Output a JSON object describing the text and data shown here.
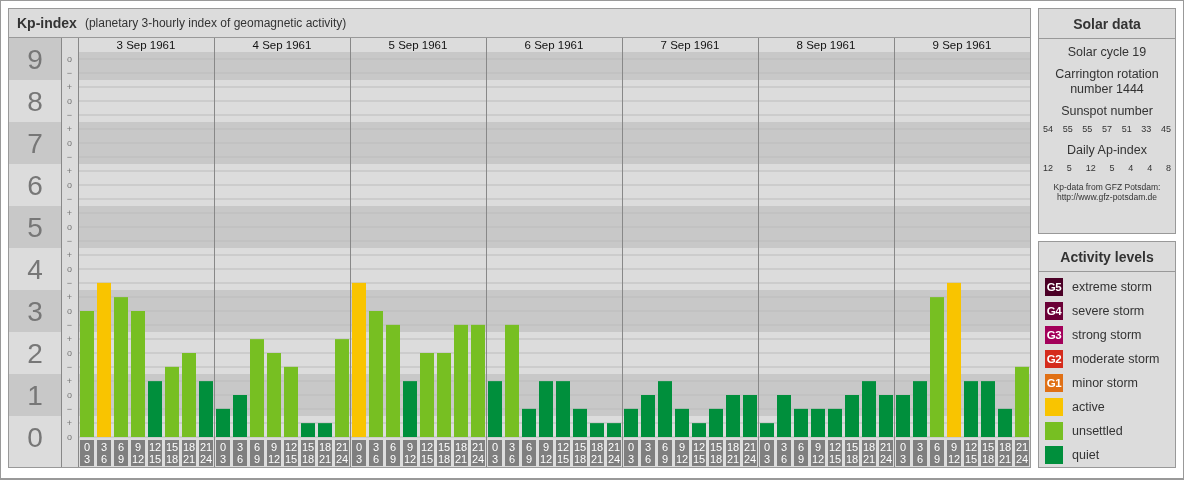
{
  "main": {
    "title": "Kp-index",
    "subtitle": "(planetary 3-hourly index of geomagnetic activity)"
  },
  "kp_chart": {
    "days": [
      {
        "date": "3 Sep 1961",
        "slots": [
          {
            "from": "0",
            "to": "3"
          },
          {
            "from": "3",
            "to": "6"
          },
          {
            "from": "6",
            "to": "9"
          },
          {
            "from": "9",
            "to": "12"
          },
          {
            "from": "12",
            "to": "15"
          },
          {
            "from": "15",
            "to": "18"
          },
          {
            "from": "18",
            "to": "21"
          },
          {
            "from": "21",
            "to": "24"
          }
        ]
      },
      {
        "date": "4 Sep 1961",
        "slots": [
          {
            "from": "0",
            "to": "3"
          },
          {
            "from": "3",
            "to": "6"
          },
          {
            "from": "6",
            "to": "9"
          },
          {
            "from": "9",
            "to": "12"
          },
          {
            "from": "12",
            "to": "15"
          },
          {
            "from": "15",
            "to": "18"
          },
          {
            "from": "18",
            "to": "21"
          },
          {
            "from": "21",
            "to": "24"
          }
        ]
      },
      {
        "date": "5 Sep 1961",
        "slots": [
          {
            "from": "0",
            "to": "3"
          },
          {
            "from": "3",
            "to": "6"
          },
          {
            "from": "6",
            "to": "9"
          },
          {
            "from": "9",
            "to": "12"
          },
          {
            "from": "12",
            "to": "15"
          },
          {
            "from": "15",
            "to": "18"
          },
          {
            "from": "18",
            "to": "21"
          },
          {
            "from": "21",
            "to": "24"
          }
        ]
      },
      {
        "date": "6 Sep 1961",
        "slots": [
          {
            "from": "0",
            "to": "3"
          },
          {
            "from": "3",
            "to": "6"
          },
          {
            "from": "6",
            "to": "9"
          },
          {
            "from": "9",
            "to": "12"
          },
          {
            "from": "12",
            "to": "15"
          },
          {
            "from": "15",
            "to": "18"
          },
          {
            "from": "18",
            "to": "21"
          },
          {
            "from": "21",
            "to": "24"
          }
        ]
      },
      {
        "date": "7 Sep 1961",
        "slots": [
          {
            "from": "0",
            "to": "3"
          },
          {
            "from": "3",
            "to": "6"
          },
          {
            "from": "6",
            "to": "9"
          },
          {
            "from": "9",
            "to": "12"
          },
          {
            "from": "12",
            "to": "15"
          },
          {
            "from": "15",
            "to": "18"
          },
          {
            "from": "18",
            "to": "21"
          },
          {
            "from": "21",
            "to": "24"
          }
        ]
      },
      {
        "date": "8 Sep 1961",
        "slots": [
          {
            "from": "0",
            "to": "3"
          },
          {
            "from": "3",
            "to": "6"
          },
          {
            "from": "6",
            "to": "9"
          },
          {
            "from": "9",
            "to": "12"
          },
          {
            "from": "12",
            "to": "15"
          },
          {
            "from": "15",
            "to": "18"
          },
          {
            "from": "18",
            "to": "21"
          },
          {
            "from": "21",
            "to": "24"
          }
        ]
      },
      {
        "date": "9 Sep 1961",
        "slots": [
          {
            "from": "0",
            "to": "3"
          },
          {
            "from": "3",
            "to": "6"
          },
          {
            "from": "6",
            "to": "9"
          },
          {
            "from": "9",
            "to": "12"
          },
          {
            "from": "12",
            "to": "15"
          },
          {
            "from": "15",
            "to": "18"
          },
          {
            "from": "18",
            "to": "21"
          },
          {
            "from": "21",
            "to": "24"
          }
        ]
      }
    ],
    "minor_ticks": [
      "o",
      "−",
      "+",
      "o",
      "−",
      "+",
      "o",
      "−",
      "+",
      "o",
      "−",
      "+",
      "o",
      "−",
      "+",
      "o",
      "−",
      "+",
      "o",
      "−",
      "+",
      "o",
      "−",
      "+",
      "o",
      "−",
      "+",
      "o"
    ],
    "chart_data": {
      "type": "bar",
      "ylim": [
        0,
        9
      ],
      "grid": true,
      "bands": [
        {
          "axis": "y",
          "from": 0.5,
          "to": 1.5
        },
        {
          "axis": "y",
          "from": 2.5,
          "to": 3.5
        },
        {
          "axis": "y",
          "from": 4.5,
          "to": 5.5
        },
        {
          "axis": "y",
          "from": 6.5,
          "to": 7.5
        },
        {
          "axis": "y",
          "from": 8.5,
          "to": 9.5
        }
      ],
      "yticks": [
        {
          "value": 0,
          "label": "0"
        },
        {
          "value": 1,
          "label": "1"
        },
        {
          "value": 2,
          "label": "2"
        },
        {
          "value": 3,
          "label": "3"
        },
        {
          "value": 4,
          "label": "4"
        },
        {
          "value": 5,
          "label": "5"
        },
        {
          "value": 6,
          "label": "6"
        },
        {
          "value": 7,
          "label": "7"
        },
        {
          "value": 8,
          "label": "8"
        },
        {
          "value": 9,
          "label": "9"
        }
      ],
      "values": [
        3,
        3.67,
        3.33,
        3,
        1.33,
        1.67,
        2,
        1.33,
        0.67,
        1,
        2.33,
        2,
        1.67,
        0.33,
        0.33,
        2.33,
        3.67,
        3,
        2.67,
        1.33,
        2,
        2,
        2.67,
        2.67,
        1.33,
        2.67,
        0.67,
        1.33,
        1.33,
        0.67,
        0.33,
        0.33,
        0.67,
        1,
        1.33,
        0.67,
        0.33,
        0.67,
        1,
        1,
        0.33,
        1,
        0.67,
        0.67,
        0.67,
        1,
        1.33,
        1,
        1,
        1.33,
        3.33,
        3.67,
        1.33,
        1.33,
        0.67,
        1.67
      ]
    }
  },
  "solar_data": {
    "title": "Solar data",
    "cycle": "Solar cycle 19",
    "carrington": "Carrington rotation number 1444",
    "sunspot": {
      "label": "Sunspot number",
      "values": [
        "54",
        "55",
        "55",
        "57",
        "51",
        "33",
        "45"
      ]
    },
    "ap_index": {
      "label": "Daily Ap-index",
      "values": [
        "12",
        "5",
        "12",
        "5",
        "4",
        "4",
        "8"
      ]
    },
    "source_note": "Kp-data from GFZ Potsdam:",
    "source_url": "http://www.gfz-potsdam.de"
  },
  "activity_levels": {
    "title": "Activity levels",
    "items": [
      {
        "kind": "g5",
        "badge": "G5",
        "label": "extreme storm",
        "color": "#4b0026"
      },
      {
        "kind": "g4",
        "badge": "G4",
        "label": "severe storm",
        "color": "#6a0036"
      },
      {
        "kind": "g3",
        "badge": "G3",
        "label": "strong storm",
        "color": "#a3005a"
      },
      {
        "kind": "g2",
        "badge": "G2",
        "label": "moderate storm",
        "color": "#d52b1c"
      },
      {
        "kind": "g1",
        "badge": "G1",
        "label": "minor storm",
        "color": "#e07015"
      },
      {
        "kind": "active",
        "label": "active",
        "color": "#f9c400"
      },
      {
        "kind": "unsettled",
        "label": "unsettled",
        "color": "#77bf22"
      },
      {
        "kind": "quiet",
        "label": "quiet",
        "color": "#008f3c"
      }
    ]
  }
}
